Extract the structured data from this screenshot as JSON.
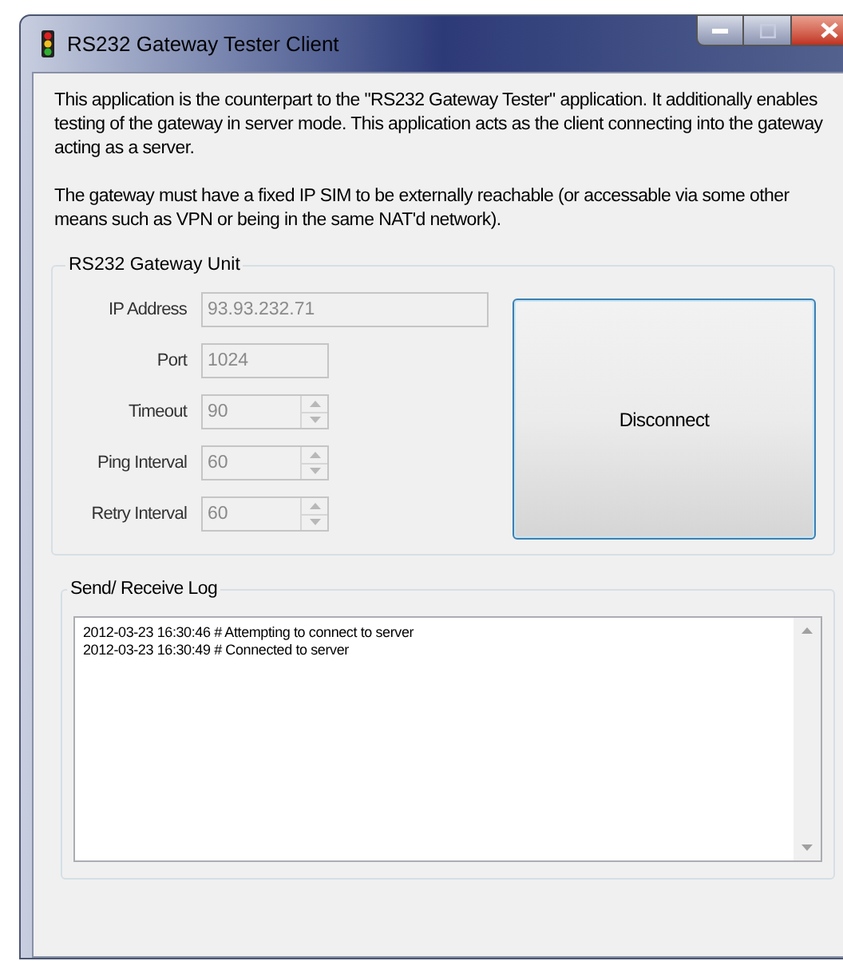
{
  "window": {
    "title": "RS232 Gateway Tester Client"
  },
  "description": [
    "This application is the counterpart to the \"RS232 Gateway Tester\" application.  It additionally enables testing of the gateway in server mode. This application acts as the client connecting into the gateway acting as a server.",
    "The gateway must have a fixed IP SIM to be externally reachable (or accessable via some other means such as VPN or being in the same NAT'd network)."
  ],
  "gateway_unit": {
    "title": "RS232 Gateway Unit",
    "fields": [
      {
        "label": "IP Address",
        "value": "93.93.232.71",
        "kind": "text",
        "disabled": true,
        "wide": true
      },
      {
        "label": "Port",
        "value": "1024",
        "kind": "text",
        "disabled": true,
        "wide": false
      },
      {
        "label": "Timeout",
        "value": "90",
        "kind": "spinner",
        "disabled": true,
        "wide": false
      },
      {
        "label": "Ping Interval",
        "value": "60",
        "kind": "spinner",
        "disabled": true,
        "wide": false
      },
      {
        "label": "Retry Interval",
        "value": "60",
        "kind": "spinner",
        "disabled": true,
        "wide": false
      }
    ],
    "button": "Disconnect"
  },
  "log": {
    "title": "Send/ Receive Log",
    "lines": [
      "2012-03-23 16:30:46 # Attempting to connect to server",
      "2012-03-23 16:30:49 # Connected to server"
    ]
  }
}
